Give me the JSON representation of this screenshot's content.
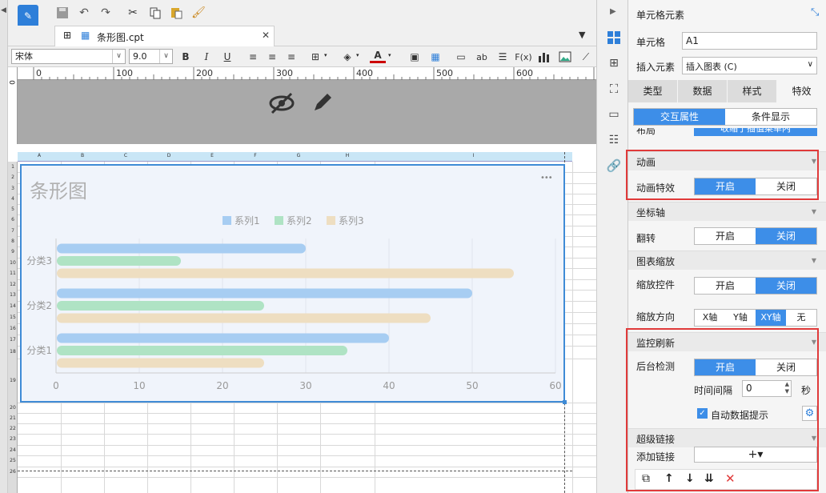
{
  "file": {
    "tab_name": "条形图.cpt"
  },
  "format": {
    "font_name": "宋体",
    "font_size": "9.0"
  },
  "ruler": {
    "marks": [
      "0",
      "100",
      "200",
      "300",
      "400",
      "500",
      "600"
    ]
  },
  "sheet": {
    "columns": [
      "A",
      "B",
      "C",
      "D",
      "E",
      "F",
      "G",
      "H",
      "I"
    ],
    "rows": [
      "1",
      "2",
      "3",
      "4",
      "5",
      "6",
      "7",
      "8",
      "9",
      "10",
      "11",
      "12",
      "13",
      "14",
      "15",
      "16",
      "17",
      "18",
      "19",
      "20",
      "21",
      "22",
      "23",
      "24",
      "25",
      "26"
    ]
  },
  "chart_data": {
    "type": "bar",
    "orientation": "horizontal",
    "title": "条形图",
    "categories": [
      "分类1",
      "分类2",
      "分类3"
    ],
    "series": [
      {
        "name": "系列1",
        "values": [
          40,
          50,
          30
        ],
        "color": "#a7cdf2"
      },
      {
        "name": "系列2",
        "values": [
          35,
          25,
          15
        ],
        "color": "#afe3c4"
      },
      {
        "name": "系列3",
        "values": [
          25,
          45,
          55
        ],
        "color": "#eedec1"
      }
    ],
    "xlim": [
      0,
      60
    ],
    "xticks": [
      "0",
      "10",
      "20",
      "30",
      "40",
      "50",
      "60"
    ],
    "grid": true,
    "legend": "top-center",
    "more_glyph": "•••"
  },
  "panel": {
    "header": "单元格元素",
    "cell_label": "单元格",
    "cell_value": "A1",
    "insert_label": "插入元素",
    "insert_value": "插入图表 (C)",
    "tabs": [
      "类型",
      "数据",
      "样式",
      "特效"
    ],
    "sub_tabs": [
      "交互属性",
      "条件显示"
    ],
    "layout_label": "布局",
    "layout_value": "收缩于插值菜单内",
    "animation": {
      "title": "动画",
      "effect_label": "动画特效",
      "on": "开启",
      "off": "关闭"
    },
    "axis": {
      "title": "坐标轴",
      "flip_label": "翻转",
      "on": "开启",
      "off": "关闭"
    },
    "zoom": {
      "title": "图表缩放",
      "ctrl_label": "缩放控件",
      "on": "开启",
      "off": "关闭",
      "dir_label": "缩放方向",
      "dirs": [
        "X轴",
        "Y轴",
        "XY轴",
        "无"
      ]
    },
    "monitor": {
      "title": "监控刷新",
      "bg_label": "后台检测",
      "on": "开启",
      "off": "关闭",
      "interval_label": "时间间隔",
      "interval_value": "0",
      "unit": "秒",
      "auto_tip": "自动数据提示"
    },
    "hyperlink": {
      "title": "超级链接",
      "add_label": "添加链接",
      "add_btn": "+▾"
    }
  },
  "colors": {
    "accent": "#3d8ee8",
    "highlight": "#e03a3a",
    "selection": "#3f8bd6"
  }
}
